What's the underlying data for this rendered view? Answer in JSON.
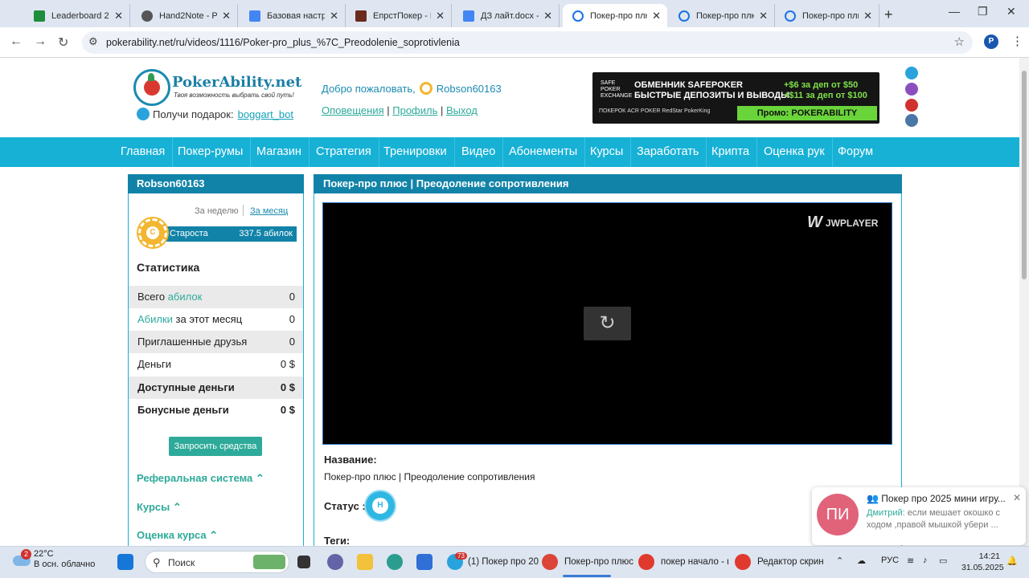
{
  "browser": {
    "tabs": [
      {
        "title": "Leaderboard 2 -",
        "color": "#1e8e3e"
      },
      {
        "title": "Hand2Note - Po",
        "color": "#555555"
      },
      {
        "title": "Базовая настро",
        "color": "#4285f4"
      },
      {
        "title": "ЕпрстПокер - П",
        "color": "#6b2a1e"
      },
      {
        "title": "ДЗ лайт.docx - G",
        "color": "#4285f4"
      },
      {
        "title": "Покер-про плюс",
        "color": "#1a73e8"
      },
      {
        "title": "Покер-про плю",
        "color": "#1a73e8"
      },
      {
        "title": "Покер-про плю",
        "color": "#1a73e8"
      }
    ],
    "url": "pokerability.net/ru/videos/1116/Poker-pro_plus_%7C_Preodolenie_soprotivlenia",
    "profile_initial": "P"
  },
  "header": {
    "brand": "PokerAbility.net",
    "slogan": "Твоя возможность выбрать свой путь!",
    "gift_text": "Получи подарок:",
    "gift_link": "boggart_bot",
    "welcome": "Добро пожаловать,",
    "username": "Robson60163",
    "links": [
      "Оповещения",
      "Профиль",
      "Выход"
    ],
    "banner": {
      "line1": "ОБМЕННИК SAFEPOKER",
      "line2": "БЫСТРЫЕ ДЕПОЗИТЫ И ВЫВОДЫ",
      "bonus1": "+$6 за деп от $50",
      "bonus2": "+$11 за деп от $100",
      "promo": "Промо: POKERABILITY",
      "sp_logo": "SAFE POKER EXCHANGE",
      "rooms": "ПОКЕРОК   ACR POKER   RedStar   PokerKing"
    }
  },
  "nav": [
    "Главная",
    "Покер-румы",
    "Магазин",
    "Стратегия",
    "Тренировки",
    "Видео",
    "Абонементы",
    "Курсы",
    "Заработать",
    "Крипта",
    "Оценка рук",
    "Форум"
  ],
  "sidebar": {
    "title": "Robson60163",
    "period_week": "За неделю",
    "period_month": "За месяц",
    "chip_letter": "С",
    "rank_name": "Староста",
    "rank_value": "337.5 абилок",
    "stats_title": "Статистика",
    "stats": [
      {
        "pre": "Всего ",
        "hl": "абилок",
        "post": "",
        "value": "0"
      },
      {
        "pre": "",
        "hl": "Абилки",
        "post": " за этот месяц",
        "value": "0"
      },
      {
        "pre": "Приглашенные друзья",
        "hl": "",
        "post": "",
        "value": "0"
      },
      {
        "pre": "Деньги",
        "hl": "",
        "post": "",
        "value": "0 $"
      },
      {
        "pre": "Доступные деньги",
        "hl": "",
        "post": "",
        "value": "0 $"
      },
      {
        "pre": "Бонусные деньги",
        "hl": "",
        "post": "",
        "value": "0 $"
      }
    ],
    "request_button": "Запросить средства",
    "sections": [
      "Реферальная система ⌃",
      "Курсы ⌃",
      "Оценка курса ⌃"
    ]
  },
  "main": {
    "title": "Покер-про плюс | Преодоление сопротивления",
    "player_brand": "JWPLAYER",
    "name_label": "Название:",
    "name_value": "Покер-про плюс | Преодоление сопротивления",
    "status_label": "Статус :",
    "status_chip": "Н",
    "tags_label": "Теги:"
  },
  "notification": {
    "avatar": "ПИ",
    "title": "Покер про 2025 мини игру...",
    "sender": "Дмитрий:",
    "message": "если мешает окошко с ходом ,правой мышкой убери ..."
  },
  "taskbar": {
    "weather_temp": "22°C",
    "weather_desc": "В осн. облачно",
    "weather_badge": "2",
    "search_placeholder": "Поиск",
    "apps": [
      {
        "label": "(1) Покер про 20",
        "badge": "73"
      },
      {
        "label": "Покер-про плюс"
      },
      {
        "label": "покер начало - ι"
      },
      {
        "label": "Редактор скрин"
      }
    ],
    "lang": "РУС",
    "time": "14:21",
    "date": "31.05.2025"
  }
}
